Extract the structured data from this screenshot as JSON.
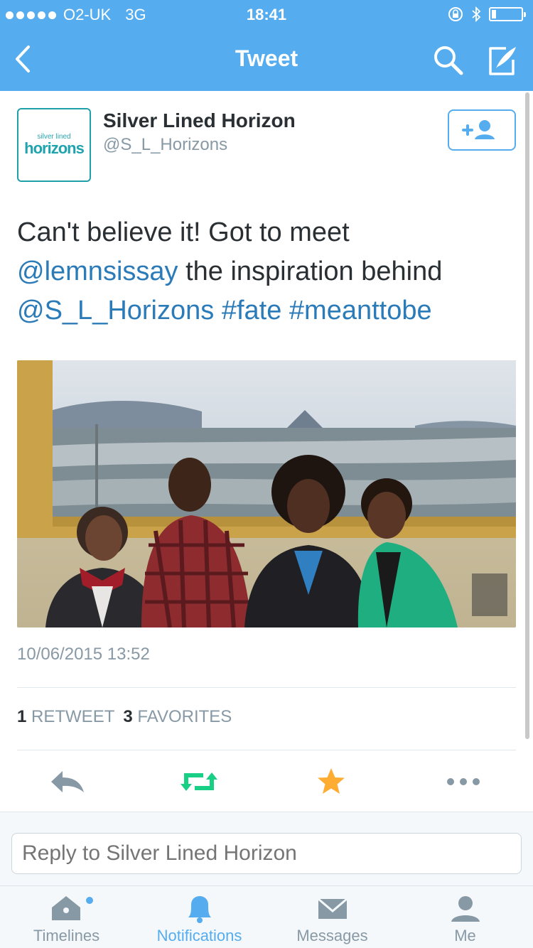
{
  "status_bar": {
    "carrier": "O2-UK",
    "network": "3G",
    "time": "18:41"
  },
  "nav": {
    "title": "Tweet"
  },
  "tweet": {
    "display_name": "Silver Lined Horizon",
    "handle": "@S_L_Horizons",
    "avatar_text_small": "silver lined",
    "avatar_text_big": "horizons",
    "text_plain_1": "Can't believe it! Got to meet",
    "mention_1": "@lemnsissay",
    "text_plain_2": " the inspiration behind",
    "mention_2": "@S_L_Horizons",
    "hashtag_1": "#fate",
    "hashtag_2": "#meanttobe",
    "timestamp": "10/06/2015 13:52",
    "retweet_count": "1",
    "retweet_label": "RETWEET",
    "favorite_count": "3",
    "favorite_label": "FAVORITES"
  },
  "reply": {
    "placeholder": "Reply to Silver Lined Horizon"
  },
  "tabs": [
    {
      "label": "Timelines",
      "icon": "home-icon"
    },
    {
      "label": "Notifications",
      "icon": "bell-icon"
    },
    {
      "label": "Messages",
      "icon": "envelope-icon"
    },
    {
      "label": "Me",
      "icon": "person-icon"
    }
  ],
  "colors": {
    "brand": "#55acee",
    "link": "#2b7bb9",
    "retweet": "#19cf86",
    "favorite": "#ffac33",
    "muted": "#8899a6"
  }
}
